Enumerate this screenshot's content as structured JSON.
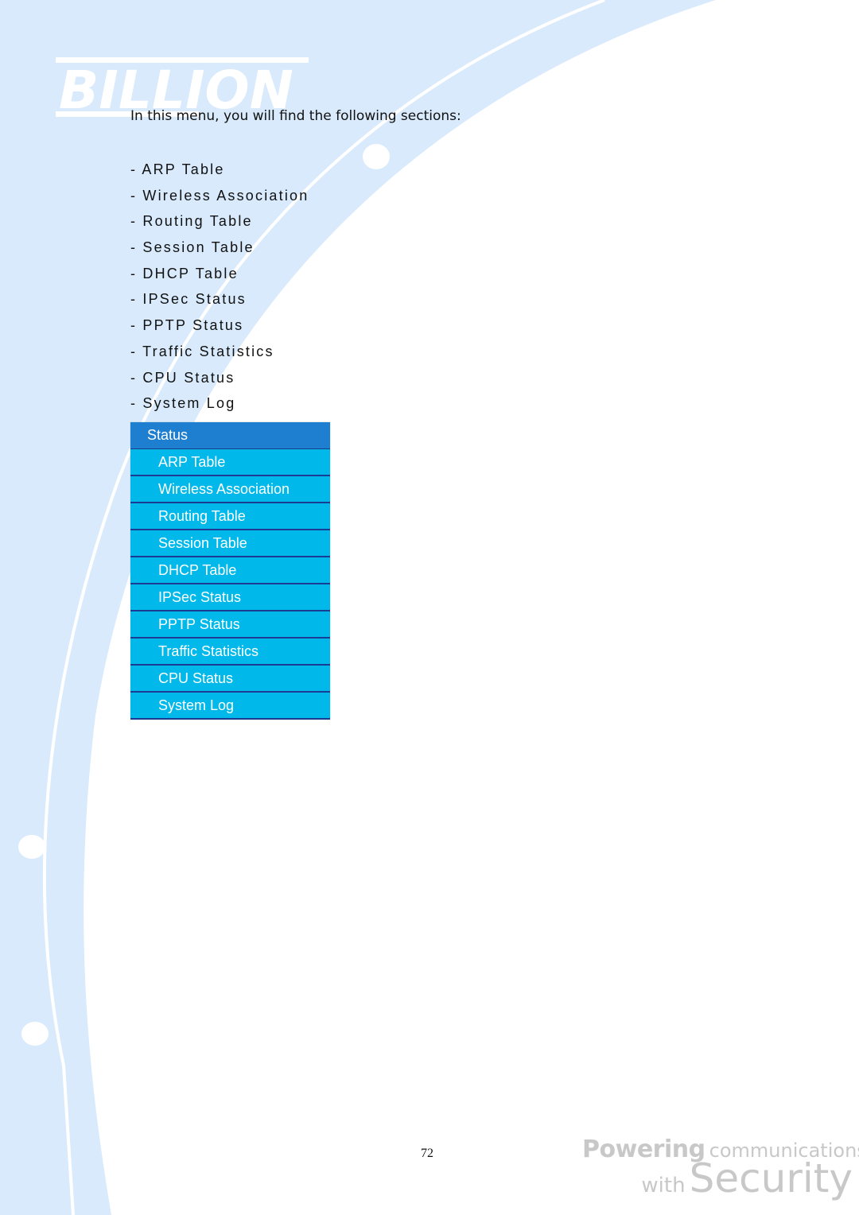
{
  "brand": {
    "logo_text": "BILLION",
    "tagline_bold": "Powering",
    "tagline_rest": "communications",
    "tagline_with": "with",
    "tagline_big": "Security"
  },
  "intro": "In this menu, you will find the following sections:",
  "sections": [
    "- ARP Table",
    "- Wireless Association",
    "- Routing Table",
    "- Session Table",
    "- DHCP Table",
    "- IPSec Status",
    "- PPTP Status",
    "- Traffic Statistics",
    "- CPU Status",
    "- System Log"
  ],
  "menu": {
    "header": "Status",
    "items": [
      "ARP Table",
      "Wireless Association",
      "Routing Table",
      "Session Table",
      "DHCP Table",
      "IPSec Status",
      "PPTP Status",
      "Traffic Statistics",
      "CPU Status",
      "System Log"
    ],
    "colors": {
      "header_bg": "#1e7fd0",
      "item_bg": "#00b9ea",
      "separator": "#1b3c93"
    }
  },
  "page_number": "72"
}
